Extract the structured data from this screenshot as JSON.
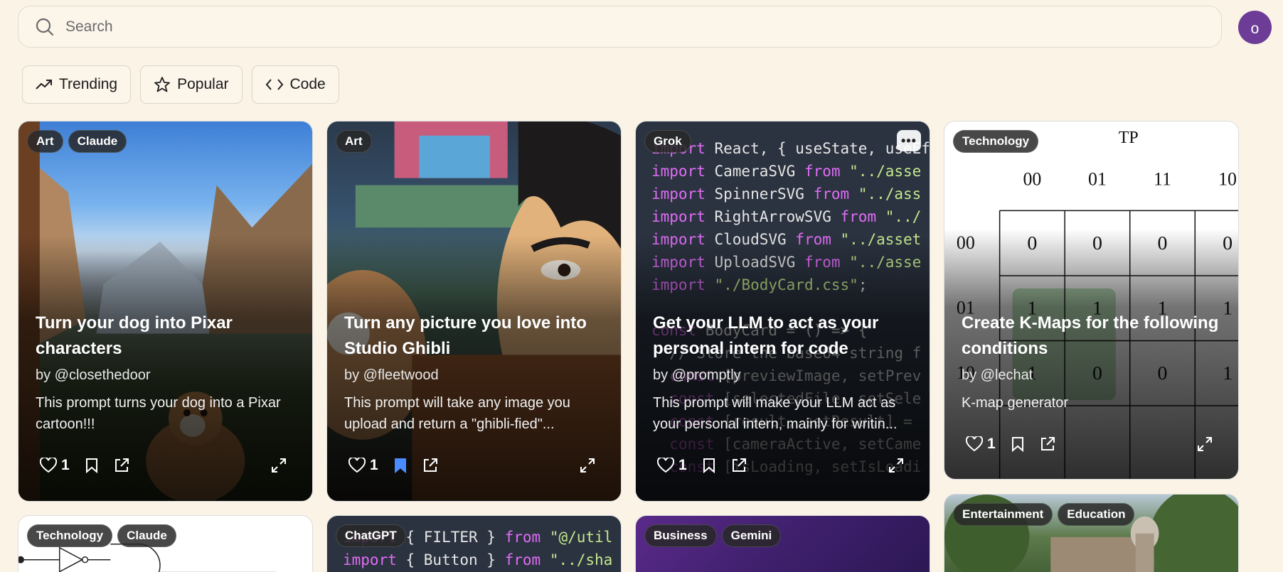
{
  "search": {
    "placeholder": "Search"
  },
  "user": {
    "avatar_letter": "o"
  },
  "tabs": [
    {
      "label": "Trending",
      "icon": "trending-icon"
    },
    {
      "label": "Popular",
      "icon": "star-icon"
    },
    {
      "label": "Code",
      "icon": "code-icon"
    }
  ],
  "cards": [
    {
      "badges": [
        "Art",
        "Claude"
      ],
      "title": "Turn your dog into Pixar characters",
      "author": "by @closethedoor",
      "description": "This prompt turns your dog into a Pixar cartoon!!!",
      "likes": "1",
      "bookmarked": false
    },
    {
      "badges": [
        "Art"
      ],
      "title": "Turn any picture you love into Studio Ghibli",
      "author": "by @fleetwood",
      "description": "This prompt will take any image you upload and return a \"ghibli-fied\"...",
      "likes": "1",
      "bookmarked": true
    },
    {
      "badges": [
        "Grok"
      ],
      "title": "Get your LLM to act as your personal intern for code",
      "author": "by @promptly",
      "description": "This prompt will make your LLM act as your personal intern, mainly for writin...",
      "likes": "1",
      "bookmarked": false,
      "code_lines": [
        "import React, { useState, useEf",
        "import CameraSVG from \"../asse",
        "import SpinnerSVG from \"../ass",
        "import RightArrowSVG from \"../",
        "import CloudSVG from \"../asset",
        "import UploadSVG from \"../asse",
        "import \"./BodyCard.css\";",
        "",
        "const BodyCard = () => {",
        "  // Store the base64 string f",
        "  const [previewImage, setPrev",
        "  const [selectedFile, setSele",
        "  const [result, setResult] =",
        "  const [cameraActive, setCame",
        "  const [isLoading, setIsLoadi"
      ]
    },
    {
      "badges": [
        "Technology"
      ],
      "title": "Create K-Maps for the following conditions",
      "author": "by @lechat",
      "description": "K-map generator",
      "likes": "1",
      "bookmarked": false,
      "kmap": {
        "label": "TP",
        "cols": [
          "00",
          "01",
          "11",
          "10"
        ],
        "rows": [
          "00",
          "01",
          "10"
        ],
        "cells": [
          [
            "0",
            "0",
            "0",
            "0"
          ],
          [
            "1",
            "1",
            "1",
            "1"
          ],
          [
            "1",
            "0",
            "0",
            "1"
          ]
        ]
      }
    },
    {
      "badges": [
        "Technology",
        "Claude"
      ]
    },
    {
      "badges": [
        "ChatGPT"
      ],
      "code_lines": [
        "import { FILTER } from \"@/util",
        "import { Button } from \"../sha"
      ]
    },
    {
      "badges": [
        "Business",
        "Gemini"
      ]
    },
    {
      "badges": [
        "Entertainment",
        "Education"
      ]
    }
  ],
  "colors": {
    "background": "#faf3e6",
    "avatar": "#6d3c97",
    "bookmark_active": "#4a8cff"
  }
}
